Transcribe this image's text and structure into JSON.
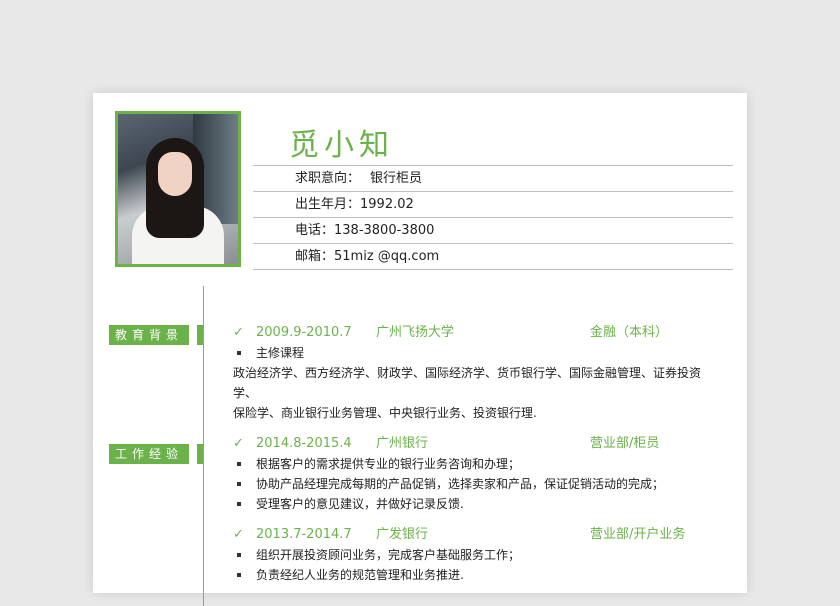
{
  "name": "觅小知",
  "info": [
    {
      "label": "求职意向：",
      "value": "银行柜员"
    },
    {
      "label": "出生年月：",
      "value": "1992.02"
    },
    {
      "label": "电话：",
      "value": "138-3800-3800"
    },
    {
      "label": "邮箱：",
      "value": "51miz @qq.com"
    }
  ],
  "education": {
    "title": "教育背景",
    "date": "2009.9-2010.7",
    "org": "广州飞扬大学",
    "role": "金融（本科）",
    "course_title": "主修课程",
    "courses_line1": "政治经济学、西方经济学、财政学、国际经济学、货币银行学、国际金融管理、证券投资学、",
    "courses_line2": "保险学、商业银行业务管理、中央银行业务、投资银行理."
  },
  "work": {
    "title": "工作经验",
    "jobs": [
      {
        "date": "2014.8-2015.4",
        "org": "广州银行",
        "role": "营业部/柜员",
        "duties": [
          "根据客户的需求提供专业的银行业务咨询和办理；",
          "协助产品经理完成每期的产品促销，选择卖家和产品，保证促销活动的完成；",
          "受理客户的意见建议，并做好记录反馈."
        ]
      },
      {
        "date": "2013.7-2014.7",
        "org": "广发银行",
        "role": "营业部/开户业务",
        "duties": [
          "组织开展投资顾问业务，完成客户基础服务工作；",
          "负责经纪人业务的规范管理和业务推进."
        ]
      }
    ]
  },
  "check_icon": "check-icon",
  "accent_color": "#6bb24a"
}
